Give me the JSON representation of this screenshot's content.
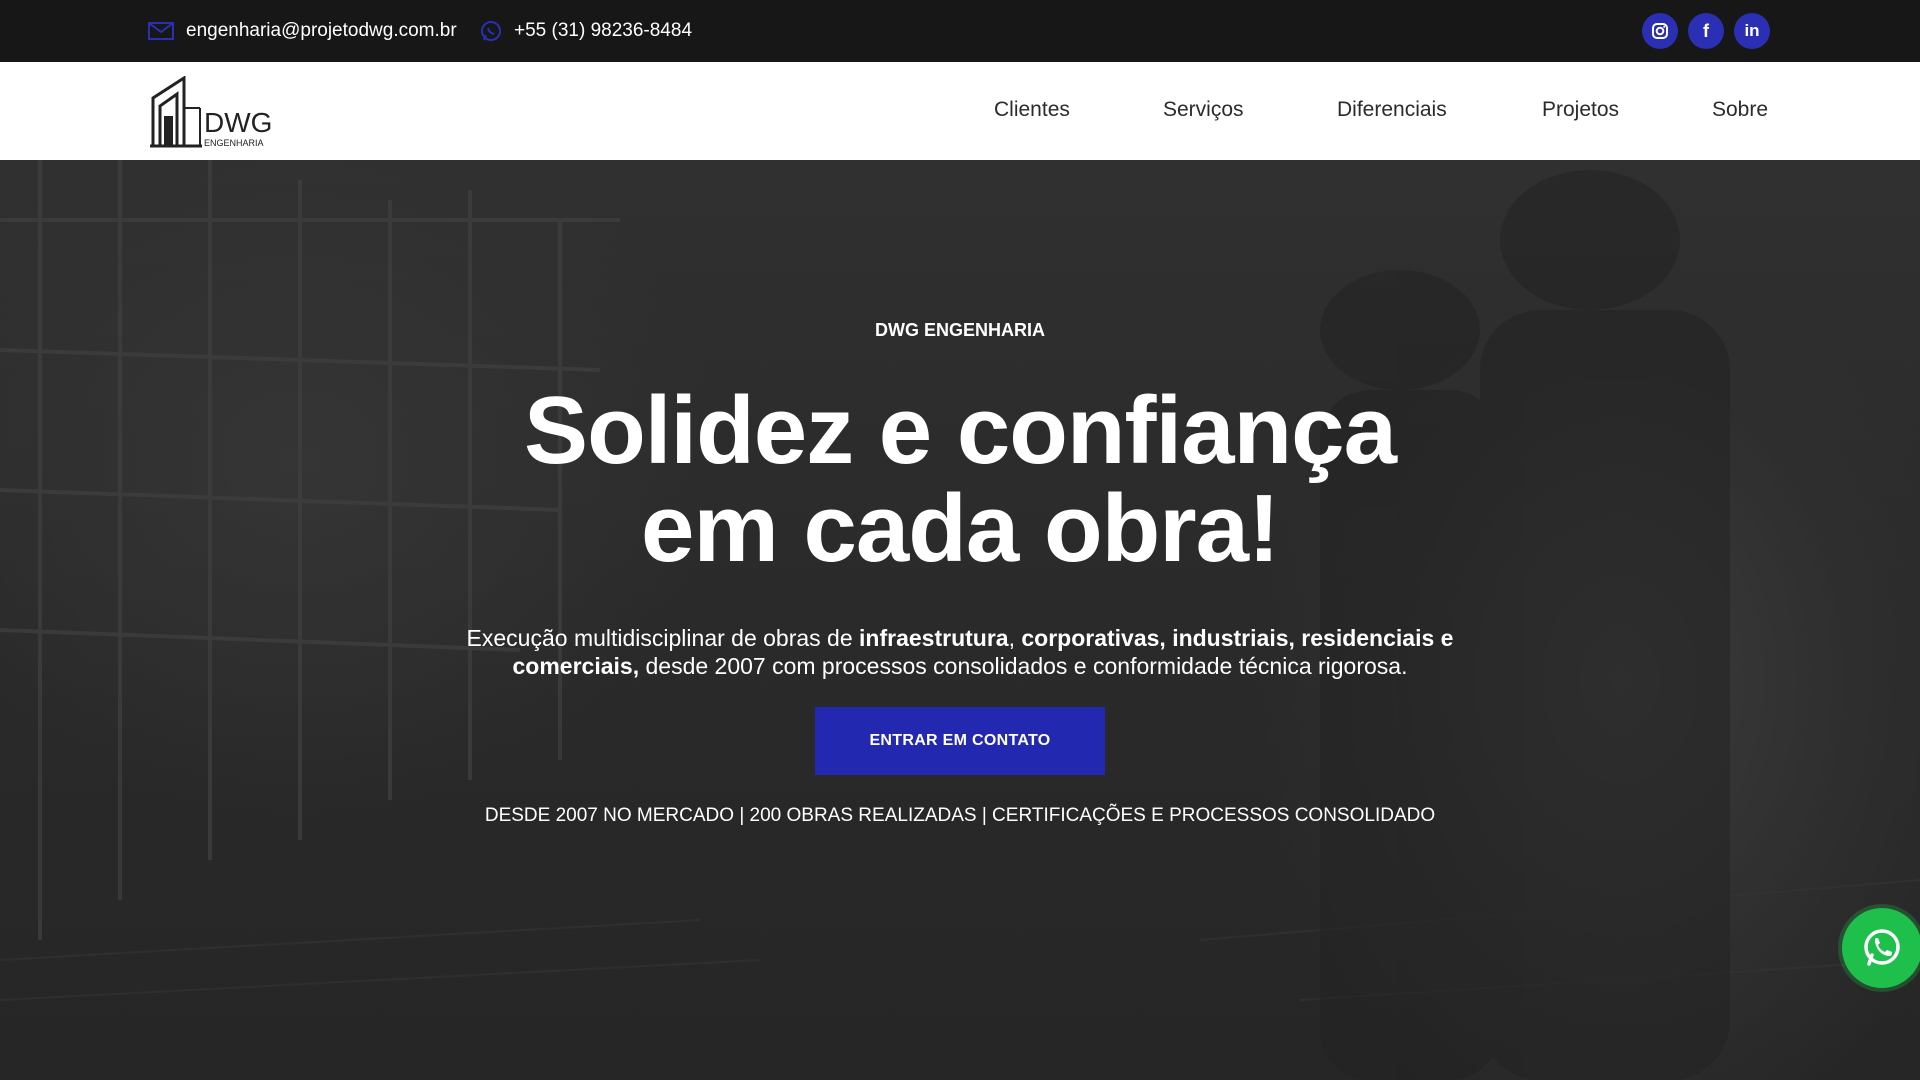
{
  "topbar": {
    "email": "engenharia@projetodwg.com.br",
    "phone": "+55 (31) 98236-8484",
    "socials": [
      {
        "icon": "instagram-icon",
        "label": ""
      },
      {
        "icon": "facebook-icon",
        "label": "f"
      },
      {
        "icon": "linkedin-icon",
        "label": "in"
      }
    ],
    "accent_color": "#2a2fb3"
  },
  "logo": {
    "brand": "DWG",
    "sub": "ENGENHARIA"
  },
  "nav": {
    "items": [
      "Clientes",
      "Serviços",
      "Diferenciais",
      "Projetos",
      "Sobre"
    ]
  },
  "hero": {
    "eyebrow": "DWG ENGENHARIA",
    "headline_line1": "Solidez e confiança",
    "headline_line2": "em cada obra!",
    "subtext": {
      "p1": "Execução multidisciplinar de obras de ",
      "b1": "infraestrutura",
      "p2": ", ",
      "b2": "corporativas, industriais, residenciais e comerciais,",
      "p3": " desde 2007 com processos consolidados e conformidade técnica rigorosa."
    },
    "cta_label": "ENTRAR EM CONTATO",
    "stats": "DESDE 2007 NO MERCADO | 200 OBRAS REALIZADAS | CERTIFICAÇÕES E PROCESSOS CONSOLIDADO",
    "cta_color": "#2328b0"
  },
  "floating": {
    "whatsapp_icon": "whatsapp-icon",
    "whatsapp_color": "#1fbf4c"
  }
}
